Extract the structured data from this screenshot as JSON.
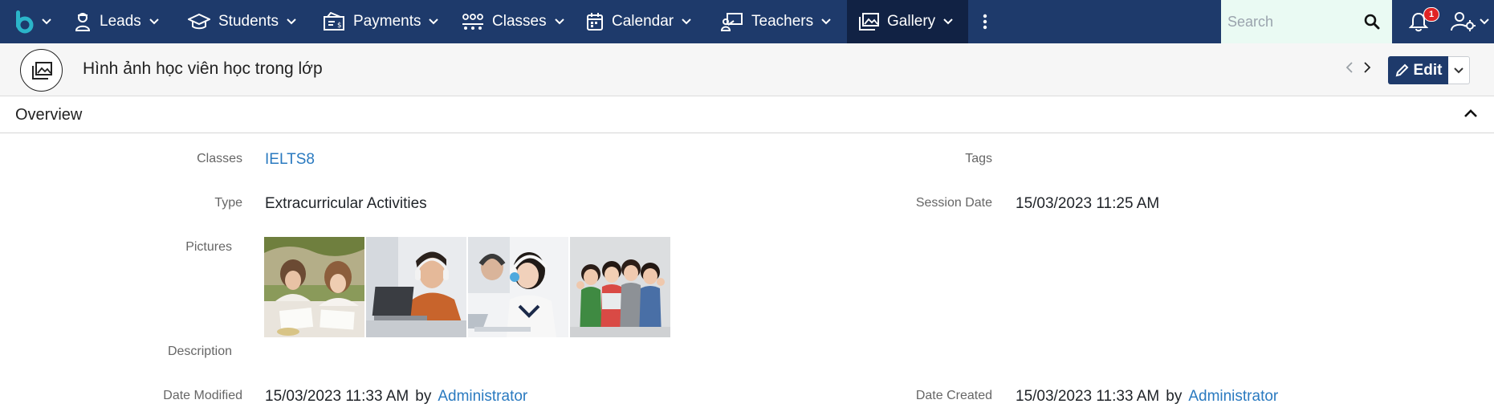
{
  "nav": {
    "items": [
      {
        "label": "Leads",
        "icon": "lead-person-icon"
      },
      {
        "label": "Students",
        "icon": "graduation-cap-icon"
      },
      {
        "label": "Payments",
        "icon": "payment-invoice-icon"
      },
      {
        "label": "Classes",
        "icon": "class-group-icon"
      },
      {
        "label": "Calendar",
        "icon": "calendar-icon"
      },
      {
        "label": "Teachers",
        "icon": "teacher-board-icon"
      },
      {
        "label": "Gallery",
        "icon": "gallery-images-icon",
        "active": true
      }
    ],
    "search_placeholder": "Search",
    "notification_count": "1"
  },
  "record": {
    "title": "Hình ảnh học viên học trong lớp",
    "edit_label": "Edit"
  },
  "overview": {
    "title": "Overview",
    "classes_label": "Classes",
    "classes_value": "IELTS8",
    "tags_label": "Tags",
    "tags_value": "",
    "type_label": "Type",
    "type_value": "Extracurricular Activities",
    "session_date_label": "Session Date",
    "session_date_value": "15/03/2023 11:25 AM",
    "pictures_label": "Pictures",
    "pictures": [
      "photo-two-girls-studying",
      "photo-student-headphones-laptop",
      "photo-girl-headphones-computer",
      "photo-group-of-children"
    ],
    "description_label": "Description",
    "date_modified_label": "Date Modified",
    "date_modified_value": "15/03/2023 11:33 AM",
    "date_modified_by_word": "by",
    "date_modified_by": "Administrator",
    "date_created_label": "Date Created",
    "date_created_value": "15/03/2023 11:33 AM",
    "date_created_by_word": "by",
    "date_created_by": "Administrator"
  },
  "colors": {
    "navbar": "#1e3a6b",
    "navbar_active": "#112244",
    "link": "#2a7ac0",
    "badge": "#e02424",
    "search_bg": "#eafaf3"
  }
}
